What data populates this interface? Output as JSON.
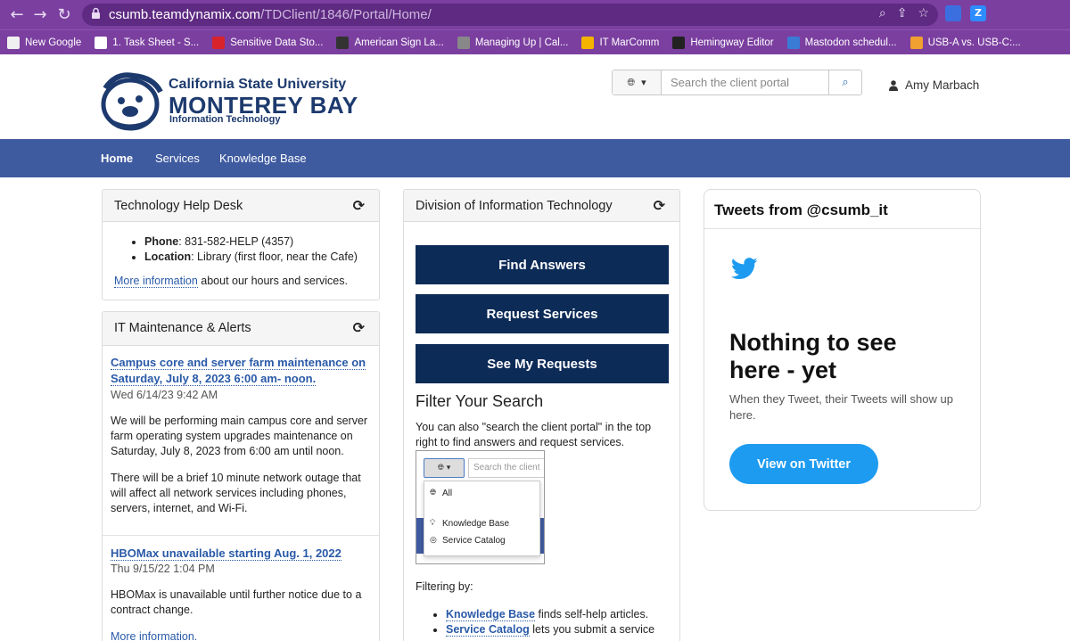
{
  "browser": {
    "url_host": "csumb.teamdynamix.com",
    "url_path": "/TDClient/1846/Portal/Home/",
    "bookmarks": [
      {
        "label": "New Google",
        "icon": "folder-icon",
        "color": "#f0f0f0"
      },
      {
        "label": "1. Task Sheet - S...",
        "icon": "check-icon",
        "color": "#ffffff"
      },
      {
        "label": "Sensitive Data Sto...",
        "icon": "sd-icon",
        "color": "#d8232a"
      },
      {
        "label": "American Sign La...",
        "icon": "asl-icon",
        "color": "#333333"
      },
      {
        "label": "Managing Up | Cal...",
        "icon": "managing-up-icon",
        "color": "#888888"
      },
      {
        "label": "IT MarComm",
        "icon": "cloud-icon",
        "color": "#f4b400"
      },
      {
        "label": "Hemingway Editor",
        "icon": "h-icon",
        "color": "#222222"
      },
      {
        "label": "Mastodon schedul...",
        "icon": "clock-icon",
        "color": "#3a7bd5"
      },
      {
        "label": "USB-A vs. USB-C:...",
        "icon": "b-icon",
        "color": "#f0a030"
      }
    ],
    "extensions": [
      {
        "icon": "bookmark-ext-icon",
        "letter": "",
        "color": "#3b6fe0"
      },
      {
        "icon": "z-ext-icon",
        "letter": "Z",
        "color": "#2d8cff"
      },
      {
        "icon": "puzzle-icon",
        "letter": "",
        "color": "#7b3fa0"
      },
      {
        "icon": "sidebar-icon",
        "letter": "",
        "color": "#7b3fa0"
      }
    ]
  },
  "header": {
    "logo_line1": "California State University",
    "logo_line2": "MONTEREY BAY",
    "logo_line3": "Information Technology",
    "search_placeholder": "Search the client portal",
    "user_name": "Amy Marbach"
  },
  "nav": {
    "items": [
      "Home",
      "Services",
      "Knowledge Base"
    ]
  },
  "helpdesk": {
    "title": "Technology Help Desk",
    "phone_label": "Phone",
    "phone_value": ": 831-582-HELP (4357)",
    "location_label": "Location",
    "location_value": ": Library (first floor, near the Cafe)",
    "more_link": "More information",
    "more_text": " about our hours and services."
  },
  "alerts": {
    "title": "IT Maintenance & Alerts",
    "items": [
      {
        "title": "Campus core and server farm maintenance on Saturday, July 8, 2023 6:00 am- noon.",
        "date": "Wed 6/14/23 9:42 AM",
        "p1": "We will be performing main campus core and server farm operating system upgrades maintenance on Saturday, July 8, 2023 from 6:00 am until noon.",
        "p2": "There will be a brief 10 minute network outage that will affect all network services including phones, servers, internet, and Wi-Fi."
      },
      {
        "title": "HBOMax unavailable starting Aug. 1, 2022",
        "date": "Thu 9/15/22 1:04 PM",
        "p1": "HBOMax is unavailable until further notice due to a contract change.",
        "link": "More information."
      }
    ]
  },
  "division": {
    "title": "Division of Information Technology",
    "buttons": [
      "Find Answers",
      "Request Services",
      "See My Requests"
    ],
    "filter_heading": "Filter Your Search",
    "filter_text": "You can also \"search the client portal\" in the top right to find answers and request services.",
    "mini": {
      "search_placeholder": "Search the client",
      "options": [
        "All",
        "Knowledge Base",
        "Service Catalog"
      ]
    },
    "filtering_by": "Filtering by:",
    "filters": [
      {
        "link": "Knowledge Base",
        "text": " finds self-help articles."
      },
      {
        "link": "Service Catalog",
        "text": " lets you submit a service"
      }
    ]
  },
  "twitter": {
    "title": "Tweets from @csumb_it",
    "heading": "Nothing to see here - yet",
    "text": "When they Tweet, their Tweets will show up here.",
    "button": "View on Twitter",
    "brand_color": "#1d9bf0"
  }
}
